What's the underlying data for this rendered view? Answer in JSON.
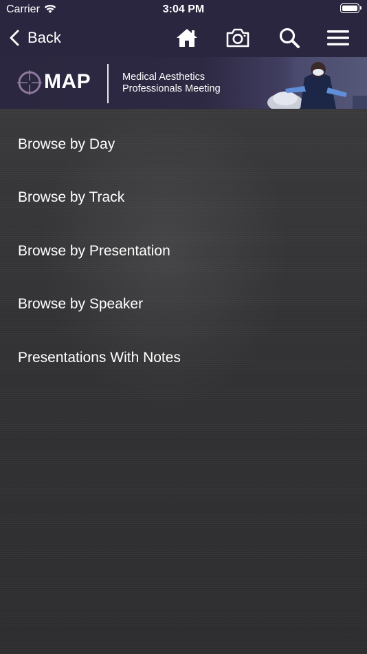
{
  "status_bar": {
    "carrier": "Carrier",
    "time": "3:04 PM"
  },
  "nav": {
    "back_label": "Back",
    "icons": [
      "home-icon",
      "camera-icon",
      "search-icon",
      "menu-icon"
    ]
  },
  "banner": {
    "logo_text": "MAP",
    "tagline_line1": "Medical Aesthetics",
    "tagline_line2": "Professionals Meeting"
  },
  "menu": {
    "items": [
      {
        "label": "Browse by Day"
      },
      {
        "label": "Browse by Track"
      },
      {
        "label": "Browse by Presentation"
      },
      {
        "label": "Browse by Speaker"
      },
      {
        "label": "Presentations With Notes"
      }
    ]
  },
  "colors": {
    "header_bg": "#2a2640",
    "menu_bg": "#333335",
    "text": "#ffffff"
  }
}
